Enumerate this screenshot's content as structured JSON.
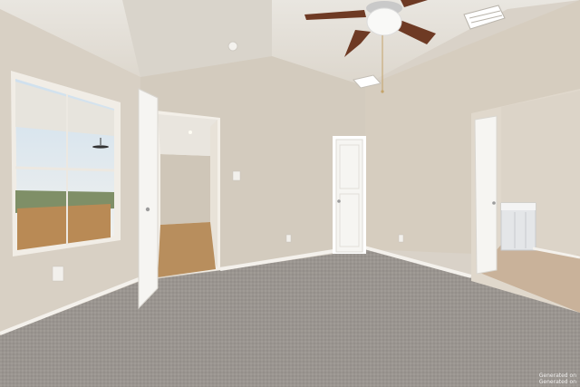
{
  "watermark": {
    "line1": "Generated on",
    "line2": "Generated on"
  },
  "colors": {
    "wall_left": "#d8d0c4",
    "wall_back": "#d3cbbe",
    "wall_right": "#d6cdbf",
    "ceiling": "#e3dfd8",
    "carpet": "#9a9590",
    "baseboard": "#f4f1ec",
    "door": "#f6f5f2",
    "fan_blade": "#6e3a24",
    "wood_floor": "#b88e5d",
    "tile_floor": "#c9b29a"
  }
}
